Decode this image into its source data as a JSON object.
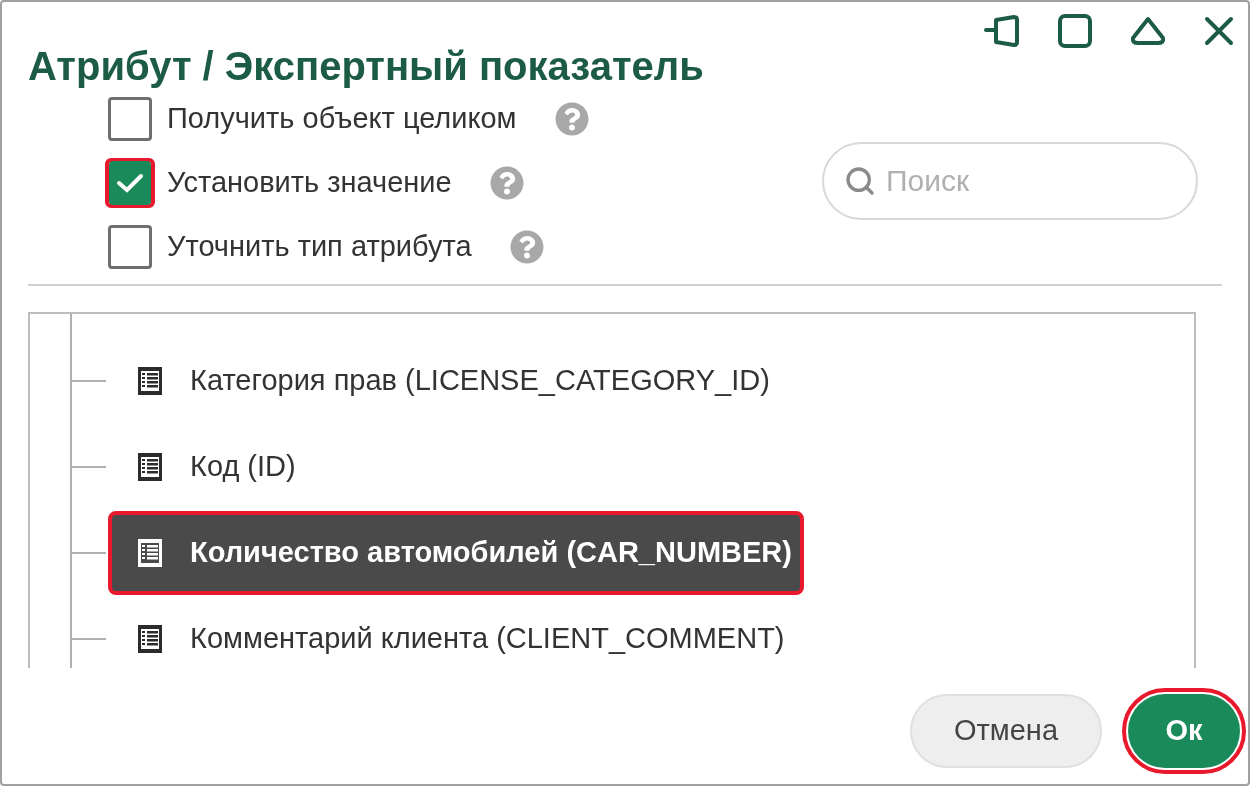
{
  "dialog": {
    "title": "Атрибут / Экспертный показатель"
  },
  "options": [
    {
      "label": "Получить объект целиком",
      "checked": false,
      "highlighted": false
    },
    {
      "label": "Установить значение",
      "checked": true,
      "highlighted": true
    },
    {
      "label": "Уточнить тип атрибута",
      "checked": false,
      "highlighted": false
    }
  ],
  "search": {
    "placeholder": "Поиск"
  },
  "tree": {
    "items": [
      {
        "label": "Категория прав (LICENSE_CATEGORY_ID)",
        "selected": false,
        "highlighted": false
      },
      {
        "label": "Код (ID)",
        "selected": false,
        "highlighted": false
      },
      {
        "label": "Количество автомобилей (CAR_NUMBER)",
        "selected": true,
        "highlighted": true
      },
      {
        "label": "Комментарий клиента (CLIENT_COMMENT)",
        "selected": false,
        "highlighted": false
      }
    ]
  },
  "buttons": [
    {
      "label": "Отмена",
      "kind": "secondary",
      "highlighted": false
    },
    {
      "label": "Ок",
      "kind": "primary",
      "highlighted": true
    }
  ]
}
